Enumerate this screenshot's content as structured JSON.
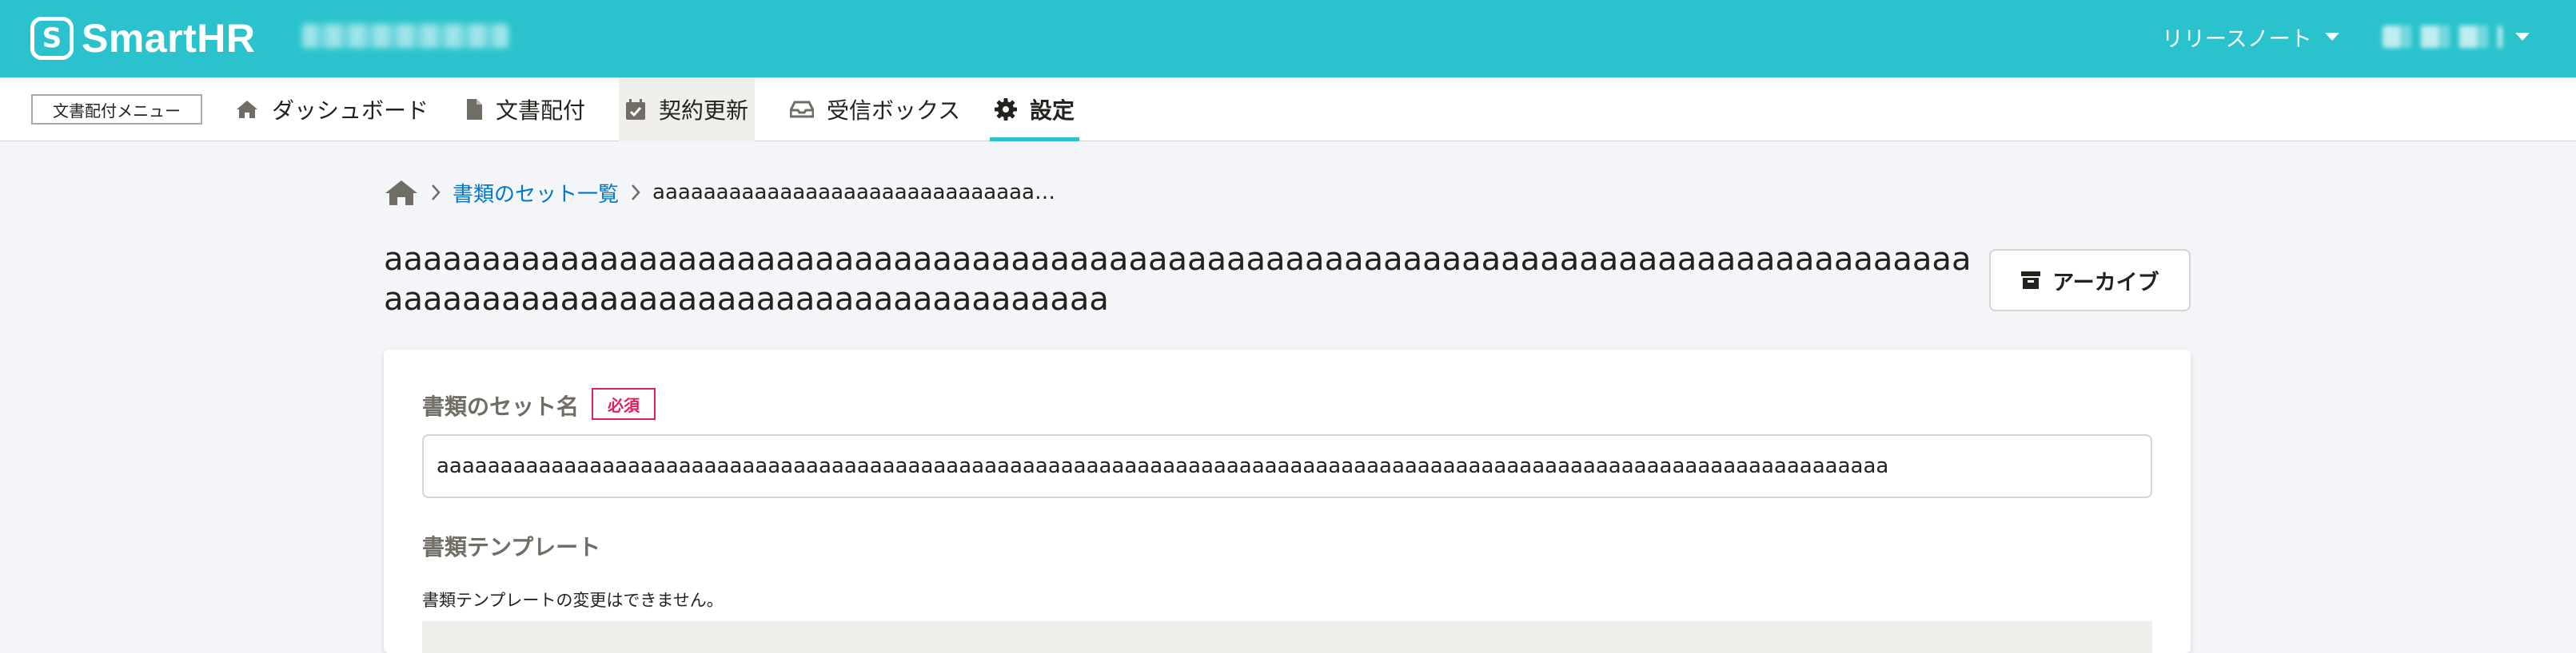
{
  "header": {
    "logo_mark": "S",
    "logo_text": "SmartHR",
    "release_notes": "リリースノート"
  },
  "subnav": {
    "menu_label": "文書配付メニュー",
    "items": [
      {
        "label": "ダッシュボード",
        "icon": "home-icon"
      },
      {
        "label": "文書配付",
        "icon": "document-icon"
      },
      {
        "label": "契約更新",
        "icon": "calendar-check-icon"
      },
      {
        "label": "受信ボックス",
        "icon": "inbox-icon"
      },
      {
        "label": "設定",
        "icon": "gear-icon"
      }
    ],
    "active_index": 4,
    "hover_index": 2
  },
  "breadcrumb": {
    "link": "書類のセット一覧",
    "current": "aaaaaaaaaaaaaaaaaaaaaaaaaaaaaa…"
  },
  "page": {
    "title": "aaaaaaaaaaaaaaaaaaaaaaaaaaaaaaaaaaaaaaaaaaaaaaaaaaaaaaaaaaaaaaaaaaaaaaaaaaaaaaaaaaaaaaaaaaaaaaaaaaaaaaaaaaaaaaaaaaaaaa",
    "archive_button": "アーカイブ"
  },
  "form": {
    "set_name_label": "書類のセット名",
    "required_badge": "必須",
    "set_name_value": "aaaaaaaaaaaaaaaaaaaaaaaaaaaaaaaaaaaaaaaaaaaaaaaaaaaaaaaaaaaaaaaaaaaaaaaaaaaaaaaaaaaaaaaaaaaaaaaaaaaaaaaaaaaaaaaaaa",
    "template_label": "書類テンプレート",
    "template_help": "書類テンプレートの変更はできません。"
  },
  "colors": {
    "brand": "#2ac3cd",
    "link": "#0077c7",
    "required": "#e01e5a"
  }
}
